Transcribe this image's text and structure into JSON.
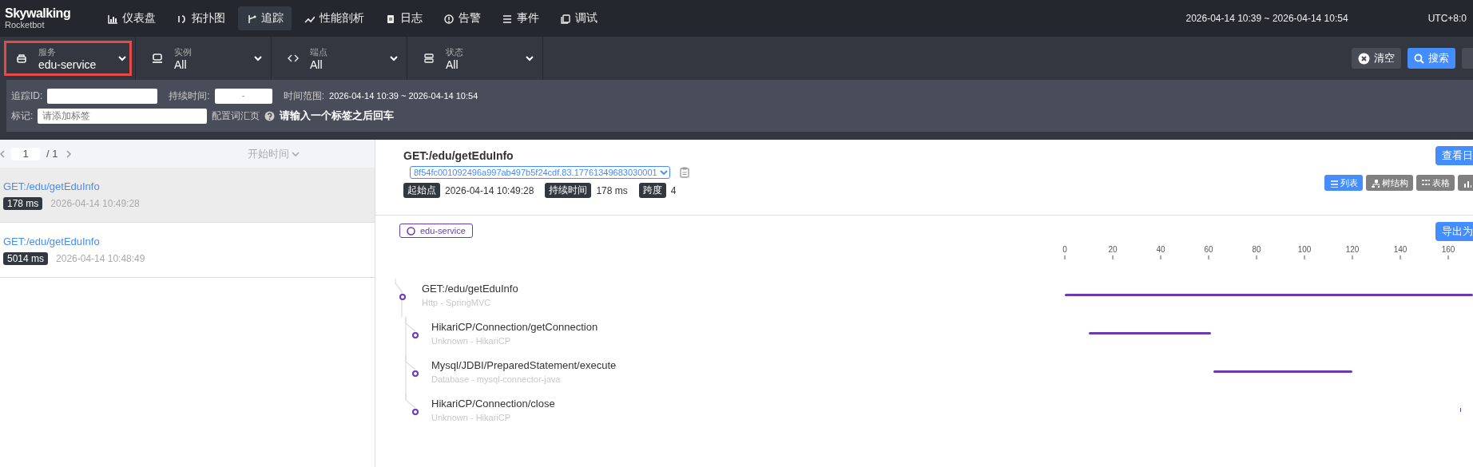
{
  "logo": {
    "name": "Skywalking",
    "subtitle": "Rocketbot"
  },
  "nav": [
    {
      "label": "仪表盘",
      "selected": false
    },
    {
      "label": "拓扑图",
      "selected": false
    },
    {
      "label": "追踪",
      "selected": true
    },
    {
      "label": "性能剖析",
      "selected": false
    },
    {
      "label": "日志",
      "selected": false
    },
    {
      "label": "告警",
      "selected": false
    },
    {
      "label": "事件",
      "selected": false
    },
    {
      "label": "调试",
      "selected": false
    }
  ],
  "time_range": "2026-04-14 10:39 ~ 2026-04-14 10:54",
  "timezone": "UTC+8:0",
  "filters": [
    {
      "label": "服务",
      "value": "edu-service",
      "highlighted": true
    },
    {
      "label": "实例",
      "value": "All",
      "highlighted": false
    },
    {
      "label": "端点",
      "value": "All",
      "highlighted": false
    },
    {
      "label": "状态",
      "value": "All",
      "highlighted": false
    }
  ],
  "actions": [
    {
      "kind": "clear",
      "label": "清空"
    },
    {
      "kind": "search",
      "label": "搜索"
    },
    {
      "kind": "more"
    }
  ],
  "search_panel": {
    "trace_id_label": "追踪ID:",
    "duration_label": "持续时间:",
    "duration_separator": "-",
    "time_range_label": "时间范围:",
    "time_range": "2026-04-14 10:39 ~ 2026-04-14 10:54",
    "tag_label": "标记:",
    "tag_placeholder": "请添加标签",
    "vocab_link": "配置词汇页",
    "hint": "请输入一个标签之后回车"
  },
  "pagination": {
    "page": "1",
    "total": "/ 1"
  },
  "sort": "开始时间",
  "traces": [
    {
      "endpoint": "GET:/edu/getEduInfo",
      "duration": "178 ms",
      "start": "2026-04-14 10:49:28",
      "selected": true
    },
    {
      "endpoint": "GET:/edu/getEduInfo",
      "duration": "5014 ms",
      "start": "2026-04-14 10:48:49",
      "selected": false
    }
  ],
  "detail": {
    "title": "GET:/edu/getEduInfo",
    "trace_id": "8f54fc001092496a997ab497b5f24cdf.83.17761349683030001",
    "info": [
      {
        "label": "起始点",
        "value": "2026-04-14 10:49:28"
      },
      {
        "label": "持续时间",
        "value": "178 ms"
      },
      {
        "label": "跨度",
        "value": "4"
      }
    ],
    "log_button": "查看日",
    "views": [
      {
        "label": "列表",
        "selected": true
      },
      {
        "label": "树结构",
        "selected": false
      },
      {
        "label": "表格",
        "selected": false
      },
      {
        "selected": false
      }
    ],
    "service_tag": "edu-service",
    "export_button": "导出为",
    "spans": [
      {
        "name": "GET:/edu/getEduInfo",
        "meta": "Http - SpringMVC",
        "children": [
          {
            "name": "HikariCP/Connection/getConnection",
            "meta": "Unknown - HikariCP"
          },
          {
            "name": "Mysql/JDBI/PreparedStatement/execute",
            "meta": "Database - mysql-connector-java"
          },
          {
            "name": "HikariCP/Connection/close",
            "meta": "Unknown - HikariCP"
          }
        ]
      }
    ],
    "axis_ticks": [
      "0",
      "20",
      "40",
      "60",
      "80",
      "100",
      "120",
      "140",
      "160"
    ]
  }
}
